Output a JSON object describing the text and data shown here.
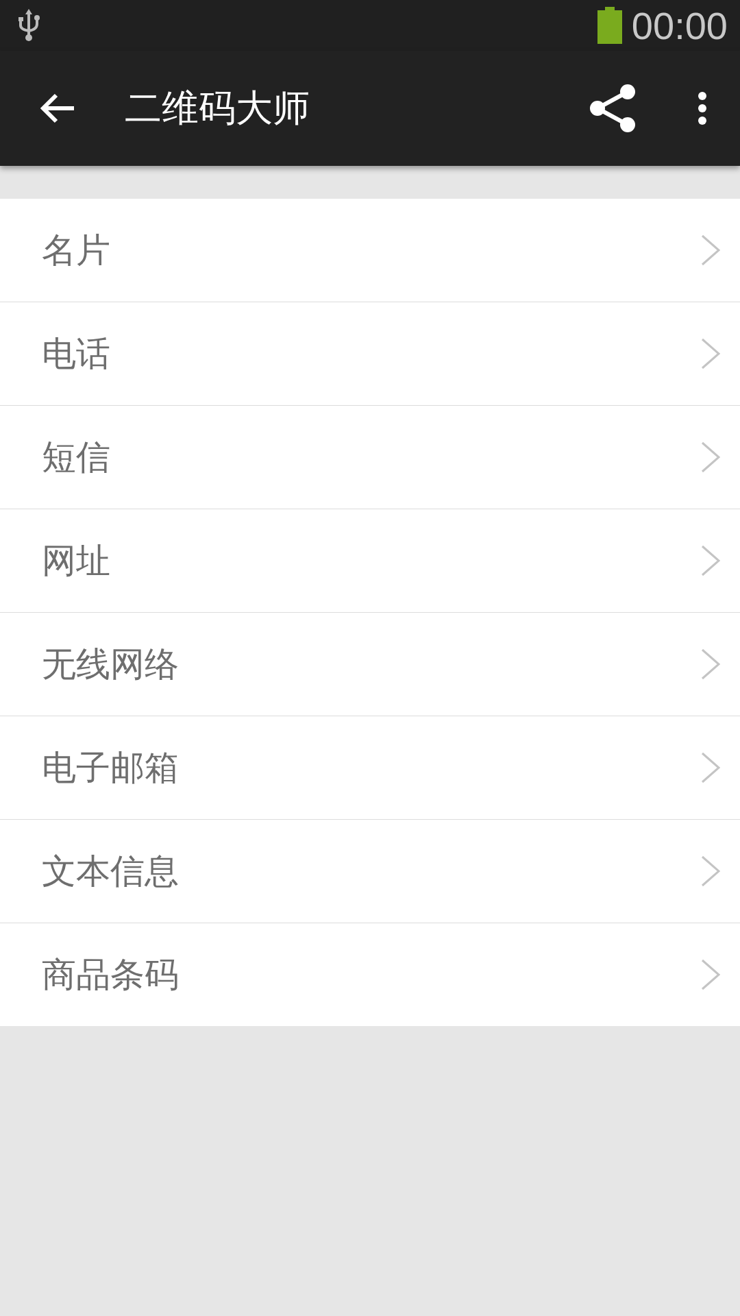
{
  "status_bar": {
    "time": "00:00"
  },
  "app_bar": {
    "title": "二维码大师"
  },
  "items": [
    {
      "label": "名片"
    },
    {
      "label": "电话"
    },
    {
      "label": "短信"
    },
    {
      "label": "网址"
    },
    {
      "label": "无线网络"
    },
    {
      "label": "电子邮箱"
    },
    {
      "label": "文本信息"
    },
    {
      "label": "商品条码"
    }
  ]
}
